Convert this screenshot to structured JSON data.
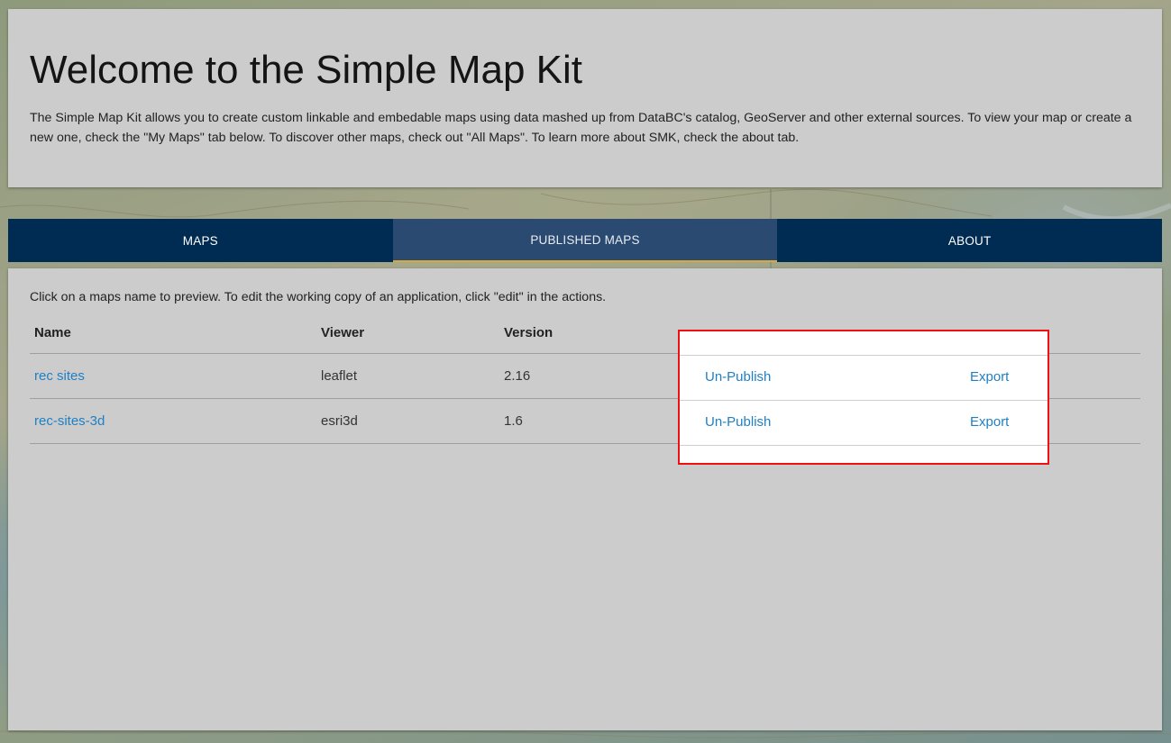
{
  "header": {
    "title": "Welcome to the Simple Map Kit",
    "intro": "The Simple Map Kit allows you to create custom linkable and embedable maps using data mashed up from DataBC's catalog, GeoServer and other external sources. To view your map or create a new one, check the \"My Maps\" tab below. To discover other maps, check out \"All Maps\". To learn more about SMK, check the about tab."
  },
  "tabs": [
    {
      "label": "MAPS",
      "active": false
    },
    {
      "label": "PUBLISHED MAPS",
      "active": true
    },
    {
      "label": "ABOUT",
      "active": false
    }
  ],
  "content": {
    "instructions": "Click on a maps name to preview. To edit the working copy of an application, click \"edit\" in the actions.",
    "columns": [
      "Name",
      "Viewer",
      "Version"
    ],
    "rows": [
      {
        "name": "rec sites",
        "viewer": "leaflet",
        "version": "2.16",
        "unpublish": "Un-Publish",
        "export": "Export"
      },
      {
        "name": "rec-sites-3d",
        "viewer": "esri3d",
        "version": "1.6",
        "unpublish": "Un-Publish",
        "export": "Export"
      }
    ]
  },
  "colors": {
    "tab_bar": "#002b52",
    "tab_active": "#2b4a72",
    "tab_active_underline": "#d8a83a",
    "link": "#1f80c4",
    "card": "#cccccc",
    "highlight_border": "#ee1111"
  }
}
